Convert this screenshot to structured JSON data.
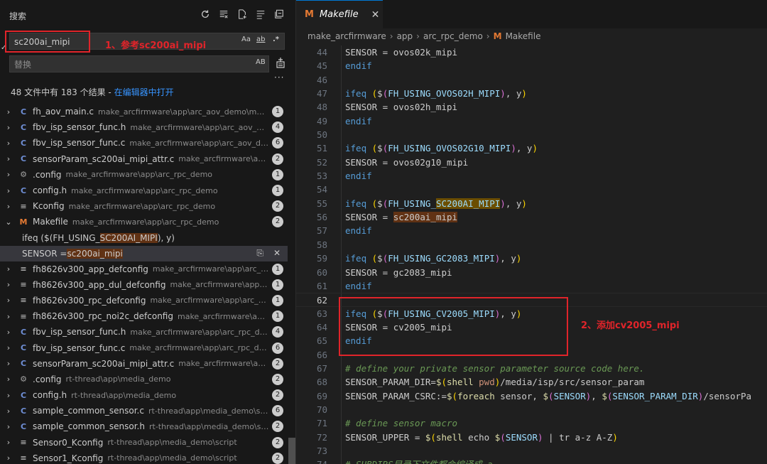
{
  "search_panel": {
    "title": "搜索",
    "search_value": "sc200ai_mipi",
    "search_options": [
      "Aa",
      "ab",
      ".*"
    ],
    "replace_placeholder": "替换",
    "replace_option": "AB",
    "summary_text": "48 文件中有 183 个结果 - ",
    "summary_link": "在编辑器中打开",
    "results": [
      {
        "icon": "C",
        "name": "fh_aov_main.c",
        "path": "make_arcfirmware\\app\\arc_aov_demo\\media\\...",
        "count": "1"
      },
      {
        "icon": "C",
        "name": "fbv_isp_sensor_func.h",
        "path": "make_arcfirmware\\app\\arc_aov_demo...",
        "count": "4"
      },
      {
        "icon": "C",
        "name": "fbv_isp_sensor_func.c",
        "path": "make_arcfirmware\\app\\arc_aov_demo...",
        "count": "6"
      },
      {
        "icon": "C",
        "name": "sensorParam_sc200ai_mipi_attr.c",
        "path": "make_arcfirmware\\app\\ar...",
        "count": "2"
      },
      {
        "icon": "gear",
        "name": ".config",
        "path": "make_arcfirmware\\app\\arc_rpc_demo",
        "count": "1"
      },
      {
        "icon": "C",
        "name": "config.h",
        "path": "make_arcfirmware\\app\\arc_rpc_demo",
        "count": "1"
      },
      {
        "icon": "lines",
        "name": "Kconfig",
        "path": "make_arcfirmware\\app\\arc_rpc_demo",
        "count": "2"
      }
    ],
    "expanded_file": {
      "icon": "M",
      "name": "Makefile",
      "path": "make_arcfirmware\\app\\arc_rpc_demo",
      "count": "2"
    },
    "matches": [
      {
        "before": "ifeq ($(FH_USING_",
        "hit": "SC200AI_MIPI",
        "after": "), y)"
      },
      {
        "before": "SENSOR = ",
        "hit": "sc200ai_mipi",
        "after": ""
      }
    ],
    "results_after": [
      {
        "icon": "lines",
        "name": "fh8626v300_app_defconfig",
        "path": "make_arcfirmware\\app\\arc_rpc_...",
        "count": "1"
      },
      {
        "icon": "lines",
        "name": "fh8626v300_app_dul_defconfig",
        "path": "make_arcfirmware\\app\\arc...",
        "count": "1"
      },
      {
        "icon": "lines",
        "name": "fh8626v300_rpc_defconfig",
        "path": "make_arcfirmware\\app\\arc_rpc_...",
        "count": "1"
      },
      {
        "icon": "lines",
        "name": "fh8626v300_rpc_noi2c_defconfig",
        "path": "make_arcfirmware\\app\\ar...",
        "count": "1"
      },
      {
        "icon": "C",
        "name": "fbv_isp_sensor_func.h",
        "path": "make_arcfirmware\\app\\arc_rpc_demo...",
        "count": "4"
      },
      {
        "icon": "C",
        "name": "fbv_isp_sensor_func.c",
        "path": "make_arcfirmware\\app\\arc_rpc_demo\\...",
        "count": "6"
      },
      {
        "icon": "C",
        "name": "sensorParam_sc200ai_mipi_attr.c",
        "path": "make_arcfirmware\\app\\ar...",
        "count": "2"
      },
      {
        "icon": "gear",
        "name": ".config",
        "path": "rt-thread\\app\\media_demo",
        "count": "2"
      },
      {
        "icon": "C",
        "name": "config.h",
        "path": "rt-thread\\app\\media_demo",
        "count": "2"
      },
      {
        "icon": "C",
        "name": "sample_common_sensor.c",
        "path": "rt-thread\\app\\media_demo\\sam...",
        "count": "6"
      },
      {
        "icon": "C",
        "name": "sample_common_sensor.h",
        "path": "rt-thread\\app\\media_demo\\sam...",
        "count": "2"
      },
      {
        "icon": "lines",
        "name": "Sensor0_Kconfig",
        "path": "rt-thread\\app\\media_demo\\script",
        "count": "2"
      },
      {
        "icon": "lines",
        "name": "Sensor1_Kconfig",
        "path": "rt-thread\\app\\media_demo\\script",
        "count": "2"
      }
    ]
  },
  "annotations": {
    "note1": "1、参考sc200ai_mipi",
    "note2": "2、添加cv2005_mipi",
    "color": "#e0242a"
  },
  "editor": {
    "tab_label": "Makefile",
    "breadcrumb": [
      "make_arcfirmware",
      "app",
      "arc_rpc_demo",
      "Makefile"
    ],
    "lines": [
      {
        "n": "44",
        "t": [
          [
            "",
            "SENSOR = ovos02k_mipi"
          ]
        ]
      },
      {
        "n": "45",
        "t": [
          [
            "k-kw",
            "endif"
          ]
        ]
      },
      {
        "n": "46",
        "t": []
      },
      {
        "n": "47",
        "t": [
          [
            "k-kw",
            "ifeq "
          ],
          [
            "k-br2",
            "("
          ],
          [
            "",
            "$"
          ],
          [
            "k-br",
            "("
          ],
          [
            "k-cyan",
            "FH_USING_OVOS02H_MIPI"
          ],
          [
            "k-br",
            ")"
          ],
          [
            "",
            ", y"
          ],
          [
            "k-br2",
            ")"
          ]
        ]
      },
      {
        "n": "48",
        "t": [
          [
            "",
            "SENSOR = ovos02h_mipi"
          ]
        ]
      },
      {
        "n": "49",
        "t": [
          [
            "k-kw",
            "endif"
          ]
        ]
      },
      {
        "n": "50",
        "t": []
      },
      {
        "n": "51",
        "t": [
          [
            "k-kw",
            "ifeq "
          ],
          [
            "k-br2",
            "("
          ],
          [
            "",
            "$"
          ],
          [
            "k-br",
            "("
          ],
          [
            "k-cyan",
            "FH_USING_OVOS02G10_MIPI"
          ],
          [
            "k-br",
            ")"
          ],
          [
            "",
            ", y"
          ],
          [
            "k-br2",
            ")"
          ]
        ]
      },
      {
        "n": "52",
        "t": [
          [
            "",
            "SENSOR = ovos02g10_mipi"
          ]
        ]
      },
      {
        "n": "53",
        "t": [
          [
            "k-kw",
            "endif"
          ]
        ]
      },
      {
        "n": "54",
        "t": []
      },
      {
        "n": "55",
        "t": [
          [
            "k-kw",
            "ifeq "
          ],
          [
            "k-br2",
            "("
          ],
          [
            "",
            "$"
          ],
          [
            "k-br",
            "("
          ],
          [
            "k-cyan",
            "FH_USING_"
          ],
          [
            "k-cyan hlw",
            "SC200AI_MIPI"
          ],
          [
            "k-br",
            ")"
          ],
          [
            "",
            ", y"
          ],
          [
            "k-br2",
            ")"
          ]
        ]
      },
      {
        "n": "56",
        "t": [
          [
            "",
            "SENSOR = "
          ],
          [
            "hlc",
            "sc200ai_mipi"
          ]
        ]
      },
      {
        "n": "57",
        "t": [
          [
            "k-kw",
            "endif"
          ]
        ]
      },
      {
        "n": "58",
        "t": []
      },
      {
        "n": "59",
        "t": [
          [
            "k-kw",
            "ifeq "
          ],
          [
            "k-br2",
            "("
          ],
          [
            "",
            "$"
          ],
          [
            "k-br",
            "("
          ],
          [
            "k-cyan",
            "FH_USING_GC2083_MIPI"
          ],
          [
            "k-br",
            ")"
          ],
          [
            "",
            ", y"
          ],
          [
            "k-br2",
            ")"
          ]
        ]
      },
      {
        "n": "60",
        "t": [
          [
            "",
            "SENSOR = gc2083_mipi"
          ]
        ]
      },
      {
        "n": "61",
        "t": [
          [
            "k-kw",
            "endif"
          ]
        ]
      },
      {
        "n": "62",
        "t": [],
        "cur": true
      },
      {
        "n": "63",
        "t": [
          [
            "k-kw",
            "ifeq "
          ],
          [
            "k-br2",
            "("
          ],
          [
            "",
            "$"
          ],
          [
            "k-br",
            "("
          ],
          [
            "k-cyan",
            "FH_USING_CV2005_MIPI"
          ],
          [
            "k-br",
            ")"
          ],
          [
            "",
            ", y"
          ],
          [
            "k-br2",
            ")"
          ]
        ]
      },
      {
        "n": "64",
        "t": [
          [
            "",
            "SENSOR = cv2005_mipi"
          ]
        ]
      },
      {
        "n": "65",
        "t": [
          [
            "k-kw",
            "endif"
          ]
        ]
      },
      {
        "n": "66",
        "t": []
      },
      {
        "n": "67",
        "t": [
          [
            "k-com",
            "# define your private sensor parameter source code here."
          ]
        ]
      },
      {
        "n": "68",
        "t": [
          [
            "",
            "SENSOR_PARAM_DIR="
          ],
          [
            "k-func",
            "$"
          ],
          [
            "k-br2",
            "("
          ],
          [
            "k-func",
            "shell "
          ],
          [
            "k-str",
            "pwd"
          ],
          [
            "k-br2",
            ")"
          ],
          [
            "",
            "/media/isp/src/sensor_param"
          ]
        ]
      },
      {
        "n": "69",
        "t": [
          [
            "",
            "SENSOR_PARAM_CSRC:="
          ],
          [
            "k-func",
            "$"
          ],
          [
            "k-br2",
            "("
          ],
          [
            "k-func",
            "foreach "
          ],
          [
            "",
            "sensor, "
          ],
          [
            "k-func",
            "$"
          ],
          [
            "k-br",
            "("
          ],
          [
            "k-cyan",
            "SENSOR"
          ],
          [
            "k-br",
            ")"
          ],
          [
            "",
            ", "
          ],
          [
            "k-func",
            "$"
          ],
          [
            "k-br",
            "("
          ],
          [
            "k-cyan",
            "SENSOR_PARAM_DIR"
          ],
          [
            "k-br",
            ")"
          ],
          [
            "",
            "/sensorPa"
          ]
        ]
      },
      {
        "n": "70",
        "t": []
      },
      {
        "n": "71",
        "t": [
          [
            "k-com",
            "# define sensor macro"
          ]
        ]
      },
      {
        "n": "72",
        "t": [
          [
            "",
            "SENSOR_UPPER = "
          ],
          [
            "k-func",
            "$"
          ],
          [
            "k-br2",
            "("
          ],
          [
            "k-func",
            "shell "
          ],
          [
            "",
            "echo "
          ],
          [
            "k-func",
            "$"
          ],
          [
            "k-br",
            "("
          ],
          [
            "k-cyan",
            "SENSOR"
          ],
          [
            "k-br",
            ")"
          ],
          [
            "",
            " | tr a-z A-Z"
          ],
          [
            "k-br2",
            ")"
          ]
        ]
      },
      {
        "n": "73",
        "t": []
      },
      {
        "n": "74",
        "t": [
          [
            "k-com",
            "# SUBDIRS目录下文件都会编译成 a"
          ]
        ]
      }
    ]
  }
}
